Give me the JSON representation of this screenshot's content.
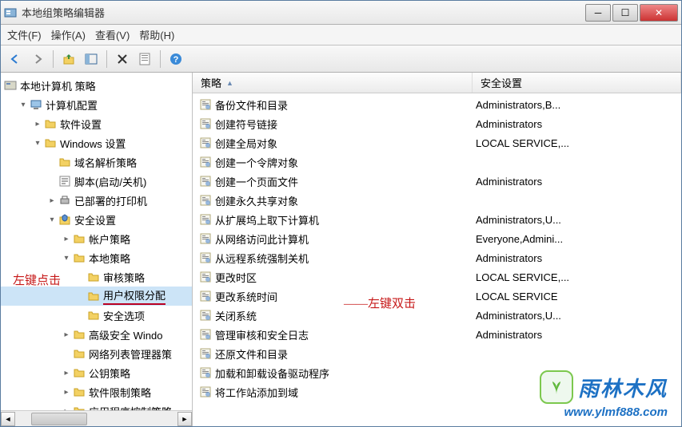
{
  "window": {
    "title": "本地组策略编辑器"
  },
  "menu": {
    "file": "文件(F)",
    "action": "操作(A)",
    "view": "查看(V)",
    "help": "帮助(H)"
  },
  "tree": {
    "root": "本地计算机 策略",
    "nodes": [
      {
        "indent": 1,
        "label": "计算机配置",
        "exp": "▾",
        "icon": "computer"
      },
      {
        "indent": 2,
        "label": "软件设置",
        "exp": "▸",
        "icon": "folder"
      },
      {
        "indent": 2,
        "label": "Windows 设置",
        "exp": "▾",
        "icon": "folder"
      },
      {
        "indent": 3,
        "label": "域名解析策略",
        "exp": " ",
        "icon": "folder"
      },
      {
        "indent": 3,
        "label": "脚本(启动/关机)",
        "exp": " ",
        "icon": "script"
      },
      {
        "indent": 3,
        "label": "已部署的打印机",
        "exp": "▸",
        "icon": "printer"
      },
      {
        "indent": 3,
        "label": "安全设置",
        "exp": "▾",
        "icon": "security"
      },
      {
        "indent": 4,
        "label": "帐户策略",
        "exp": "▸",
        "icon": "folder"
      },
      {
        "indent": 4,
        "label": "本地策略",
        "exp": "▾",
        "icon": "folder"
      },
      {
        "indent": 5,
        "label": "审核策略",
        "exp": " ",
        "icon": "folder"
      },
      {
        "indent": 5,
        "label": "用户权限分配",
        "exp": " ",
        "icon": "folder",
        "sel": true
      },
      {
        "indent": 5,
        "label": "安全选项",
        "exp": " ",
        "icon": "folder"
      },
      {
        "indent": 4,
        "label": "高级安全 Windo",
        "exp": "▸",
        "icon": "folder"
      },
      {
        "indent": 4,
        "label": "网络列表管理器策",
        "exp": " ",
        "icon": "folder"
      },
      {
        "indent": 4,
        "label": "公钥策略",
        "exp": "▸",
        "icon": "folder"
      },
      {
        "indent": 4,
        "label": "软件限制策略",
        "exp": "▸",
        "icon": "folder"
      },
      {
        "indent": 4,
        "label": "应用程序控制策略",
        "exp": "▸",
        "icon": "folder"
      }
    ]
  },
  "list": {
    "col1": "策略",
    "col2": "安全设置",
    "items": [
      {
        "name": "备份文件和目录",
        "value": "Administrators,B..."
      },
      {
        "name": "创建符号链接",
        "value": "Administrators"
      },
      {
        "name": "创建全局对象",
        "value": "LOCAL SERVICE,..."
      },
      {
        "name": "创建一个令牌对象",
        "value": ""
      },
      {
        "name": "创建一个页面文件",
        "value": "Administrators"
      },
      {
        "name": "创建永久共享对象",
        "value": ""
      },
      {
        "name": "从扩展坞上取下计算机",
        "value": "Administrators,U..."
      },
      {
        "name": "从网络访问此计算机",
        "value": "Everyone,Admini..."
      },
      {
        "name": "从远程系统强制关机",
        "value": "Administrators"
      },
      {
        "name": "更改时区",
        "value": "LOCAL SERVICE,..."
      },
      {
        "name": "更改系统时间",
        "value": "LOCAL SERVICE",
        "hl": true
      },
      {
        "name": "关闭系统",
        "value": "Administrators,U..."
      },
      {
        "name": "管理审核和安全日志",
        "value": "Administrators"
      },
      {
        "name": "还原文件和目录",
        "value": ""
      },
      {
        "name": "加载和卸载设备驱动程序",
        "value": ""
      },
      {
        "name": "将工作站添加到域",
        "value": ""
      }
    ]
  },
  "annot": {
    "left_click": "左键点击",
    "dbl_click": "——左键双击"
  },
  "watermark": {
    "brand": "雨林木风",
    "url": "www.ylmf888.com"
  }
}
